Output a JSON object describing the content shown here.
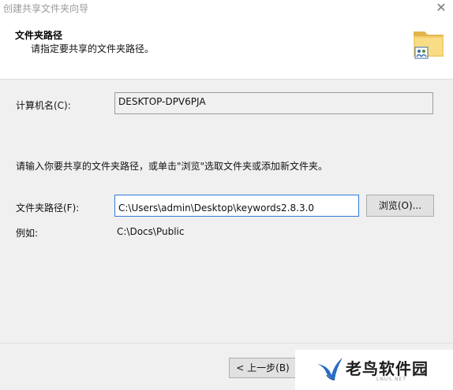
{
  "window": {
    "title": "创建共享文件夹向导",
    "close_symbol": "✕"
  },
  "header": {
    "title": "文件夹路径",
    "subtitle": "请指定要共享的文件夹路径。",
    "icon": "shared-folder-icon"
  },
  "form": {
    "computer_label": "计算机名(C):",
    "computer_value": "DESKTOP-DPV6PJA",
    "instruction": "请输入你要共享的文件夹路径，或单击\"浏览\"选取文件夹或添加新文件夹。",
    "path_label": "文件夹路径(F):",
    "path_value": "C:\\Users\\admin\\Desktop\\keywords2.8.3.0",
    "browse_label": "浏览(O)...",
    "example_label": "例如:",
    "example_value": "C:\\Docs\\Public"
  },
  "footer": {
    "back_label": "< 上一步(B)"
  },
  "watermark": {
    "name": "老鸟软件园",
    "url": "LNUS.NET"
  },
  "colors": {
    "content_bg": "#f0f0f0",
    "input_focus_border": "#2f7bd6",
    "watermark_blue": "#2b6cc4"
  }
}
